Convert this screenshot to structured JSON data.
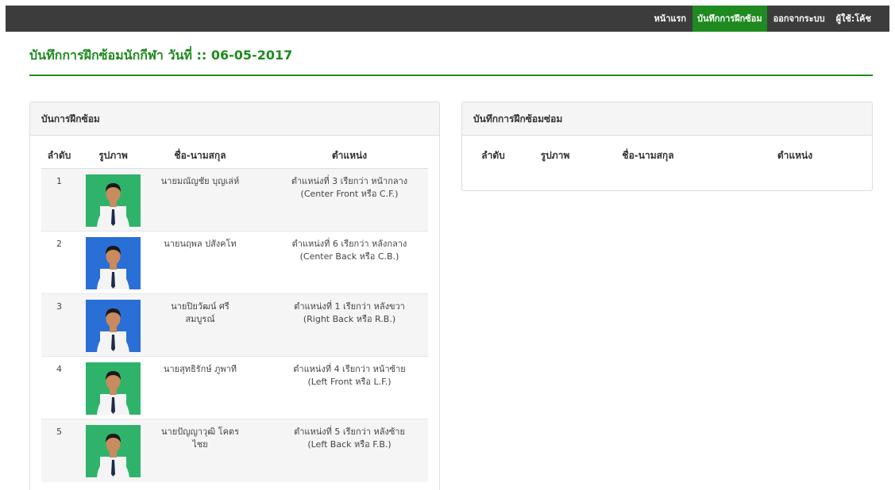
{
  "nav": {
    "home": "หน้าแรก",
    "training_log": "บันทึกการฝึกซ้อม",
    "logout": "ออกจากระบบ",
    "user": "ผู้ใช้:โค้ช"
  },
  "page": {
    "title": "บันทึกการฝึกซ้อมนักกีฬา  วันที่ :: 06-05-2017"
  },
  "left_panel": {
    "heading": "บันการฝึกซ้อม",
    "columns": [
      "ลำดับ",
      "รูปภาพ",
      "ชื่อ-นามสกุล",
      "ตำแหน่ง"
    ],
    "rows": [
      {
        "no": "1",
        "name_line1": "นายมณัญชัย บุญเล่ห์",
        "name_line2": "",
        "pos_line1": "ตำแหน่งที่ 3 เรียกว่า หน้ากลาง",
        "pos_line2": "(Center Front หรือ C.F.)",
        "photo_bg": "green"
      },
      {
        "no": "2",
        "name_line1": "นายนฤพล ปสังคโท",
        "name_line2": "",
        "pos_line1": "ตำแหน่งที่ 6 เรียกว่า หลังกลาง",
        "pos_line2": "(Center Back หรือ C.B.)",
        "photo_bg": "blue"
      },
      {
        "no": "3",
        "name_line1": "นายปิยวัฒน์ ศรี",
        "name_line2": "สมบูรณ์",
        "pos_line1": "ตำแหน่งที่ 1 เรียกว่า หลังขวา",
        "pos_line2": "(Right Back หรือ R.B.)",
        "photo_bg": "blue"
      },
      {
        "no": "4",
        "name_line1": "นายสุทธิรักษ์ ภูพาที",
        "name_line2": "",
        "pos_line1": "ตำแหน่งที่ 4 เรียกว่า หน้าซ้าย",
        "pos_line2": "(Left Front หรือ L.F.)",
        "photo_bg": "green"
      },
      {
        "no": "5",
        "name_line1": "นายปัญญาวุฒิ โคตร",
        "name_line2": "ไชย",
        "pos_line1": "ตำแหน่งที่ 5 เรียกว่า หลังซ้าย",
        "pos_line2": "(Left Back หรือ F.B.)",
        "photo_bg": "green"
      }
    ]
  },
  "right_panel": {
    "heading": "บันทึกการฝึกซ้อมซ่อม",
    "columns": [
      "ลำดับ",
      "รูปภาพ",
      "ชื่อ-นามสกุล",
      "ตำแหน่ง"
    ]
  },
  "colors": {
    "accent": "#1f8a1f",
    "topbar": "#3c3c3c",
    "photo_green": "#2fb36b",
    "photo_blue": "#2a6fd6"
  }
}
